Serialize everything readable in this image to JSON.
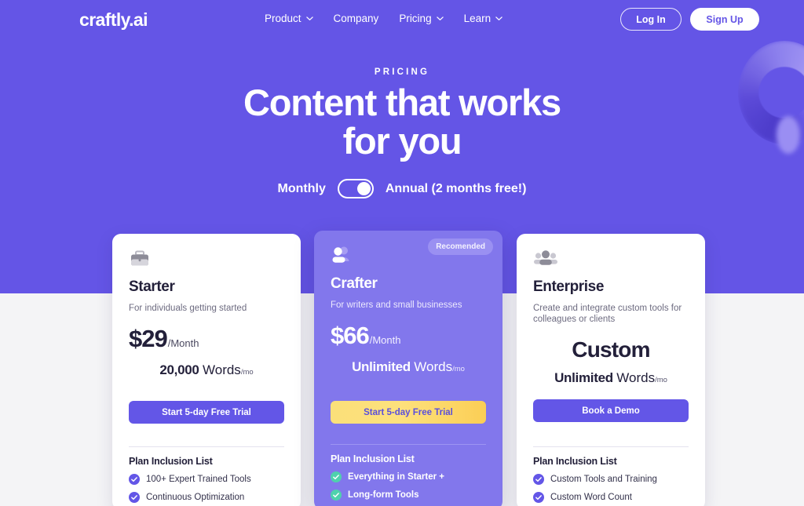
{
  "nav": {
    "logo": "craftly.ai",
    "links": [
      {
        "label": "Product",
        "has_caret": true
      },
      {
        "label": "Company",
        "has_caret": false
      },
      {
        "label": "Pricing",
        "has_caret": true
      },
      {
        "label": "Learn",
        "has_caret": true
      }
    ],
    "login_label": "Log In",
    "signup_label": "Sign Up"
  },
  "hero": {
    "eyebrow": "PRICING",
    "title_line1": "Content that works",
    "title_line2": "for you"
  },
  "billing": {
    "monthly_label": "Monthly",
    "annual_label": "Annual (2 months free!)",
    "selected": "Annual"
  },
  "plans": [
    {
      "icon": "briefcase-icon",
      "name": "Starter",
      "description": "For individuals getting started",
      "price": "$29",
      "price_period": "/Month",
      "words_strong": "20,000",
      "words_plain": "Words",
      "words_period": "/mo",
      "cta_label": "Start 5-day Free Trial",
      "inclusion_title": "Plan Inclusion List",
      "features": [
        "100+ Expert Trained Tools",
        "Continuous Optimization"
      ]
    },
    {
      "icon": "two-people-icon",
      "badge": "Recomended",
      "name": "Crafter",
      "description": "For writers and small businesses",
      "price": "$66",
      "price_period": "/Month",
      "words_strong": "Unlimited",
      "words_plain": "Words",
      "words_period": "/mo",
      "cta_label": "Start 5-day Free Trial",
      "inclusion_title": "Plan Inclusion List",
      "features": [
        "Everything in Starter +",
        "Long-form Tools"
      ]
    },
    {
      "icon": "group-people-icon",
      "name": "Enterprise",
      "description": "Create and integrate custom tools for colleagues or clients",
      "price_custom": "Custom",
      "words_strong": "Unlimited",
      "words_plain": "Words",
      "words_period": "/mo",
      "cta_label": "Book a Demo",
      "inclusion_title": "Plan Inclusion List",
      "features": [
        "Custom Tools and Training",
        "Custom Word Count"
      ]
    }
  ],
  "colors": {
    "hero_purple": "#6455e6",
    "card_purple": "#8277ec",
    "accent_button": "#6356e7",
    "highlight_yellow": "#fbe07a",
    "check_purple": "#6356e7",
    "check_green": "#4fd1ad"
  }
}
